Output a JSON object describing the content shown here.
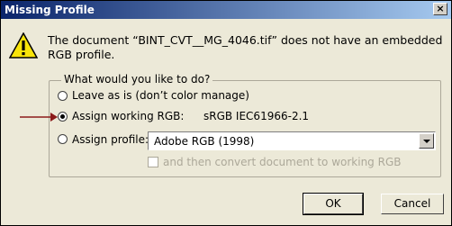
{
  "window": {
    "title": "Missing Profile",
    "close_label": "×"
  },
  "message": "The document “BINT_CVT__MG_4046.tif” does not have an embedded RGB profile.",
  "group": {
    "legend": "What would you like to do?"
  },
  "options": {
    "leave": {
      "label": "Leave as is (don’t color manage)",
      "checked": false
    },
    "assign_working": {
      "label": "Assign working RGB:",
      "value": "sRGB IEC61966-2.1",
      "checked": true
    },
    "assign_profile": {
      "label": "Assign profile:",
      "selected": "Adobe RGB (1998)",
      "checked": false
    }
  },
  "convert_checkbox": {
    "label": "and then convert document to working RGB",
    "checked": false,
    "enabled": false
  },
  "buttons": {
    "ok": "OK",
    "cancel": "Cancel"
  },
  "colors": {
    "title_start": "#0a246a",
    "title_end": "#a6caf0",
    "arrow": "#8b1a1a",
    "dialog_bg": "#ece9d8"
  }
}
